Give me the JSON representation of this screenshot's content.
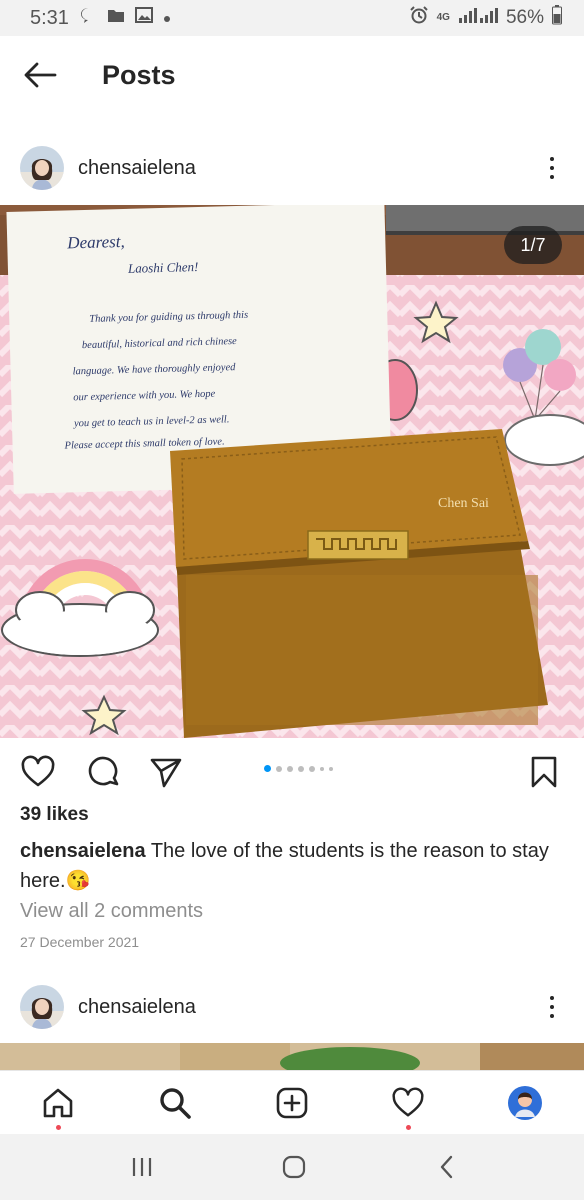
{
  "status_bar": {
    "time": "5:31",
    "network": "4G",
    "battery": "56%",
    "icons": [
      "chat-bubble-icon",
      "folder-icon",
      "image-icon",
      "dot-icon",
      "alarm-icon",
      "signal-icon",
      "battery-icon"
    ]
  },
  "header": {
    "title": "Posts"
  },
  "post": {
    "username": "chensaielena",
    "image_counter": "1/7",
    "slide_count": 7,
    "active_slide": 1,
    "photo": {
      "note_lines": [
        "Dearest,",
        "Laoshi Chen!",
        "Thank you for guiding us through this",
        "beautiful, historical and rich chinese",
        "language. We have thoroughly enjoyed",
        "our experience with you. We hope",
        "you get to teach us in level-2 as well.",
        "Please accept this small token of love."
      ],
      "engraving": "Chen Sai"
    },
    "likes": "39 likes",
    "caption_user": "chensaielena",
    "caption_text": "The love of the students is the reason to stay here.",
    "caption_emoji": "😘",
    "view_comments": "View all 2 comments",
    "date": "27 December 2021"
  },
  "next_post": {
    "username": "chensaielena"
  },
  "colors": {
    "text": "#262626",
    "secondary_text": "#8e8e8e",
    "accent_blue": "#0095f6",
    "notification_red": "#ed4956"
  },
  "bottom_nav": [
    "home-icon",
    "search-icon",
    "add-post-icon",
    "activity-heart-icon",
    "profile-avatar"
  ],
  "system_nav": [
    "recents-icon",
    "home-circle-icon",
    "back-chevron-icon"
  ]
}
